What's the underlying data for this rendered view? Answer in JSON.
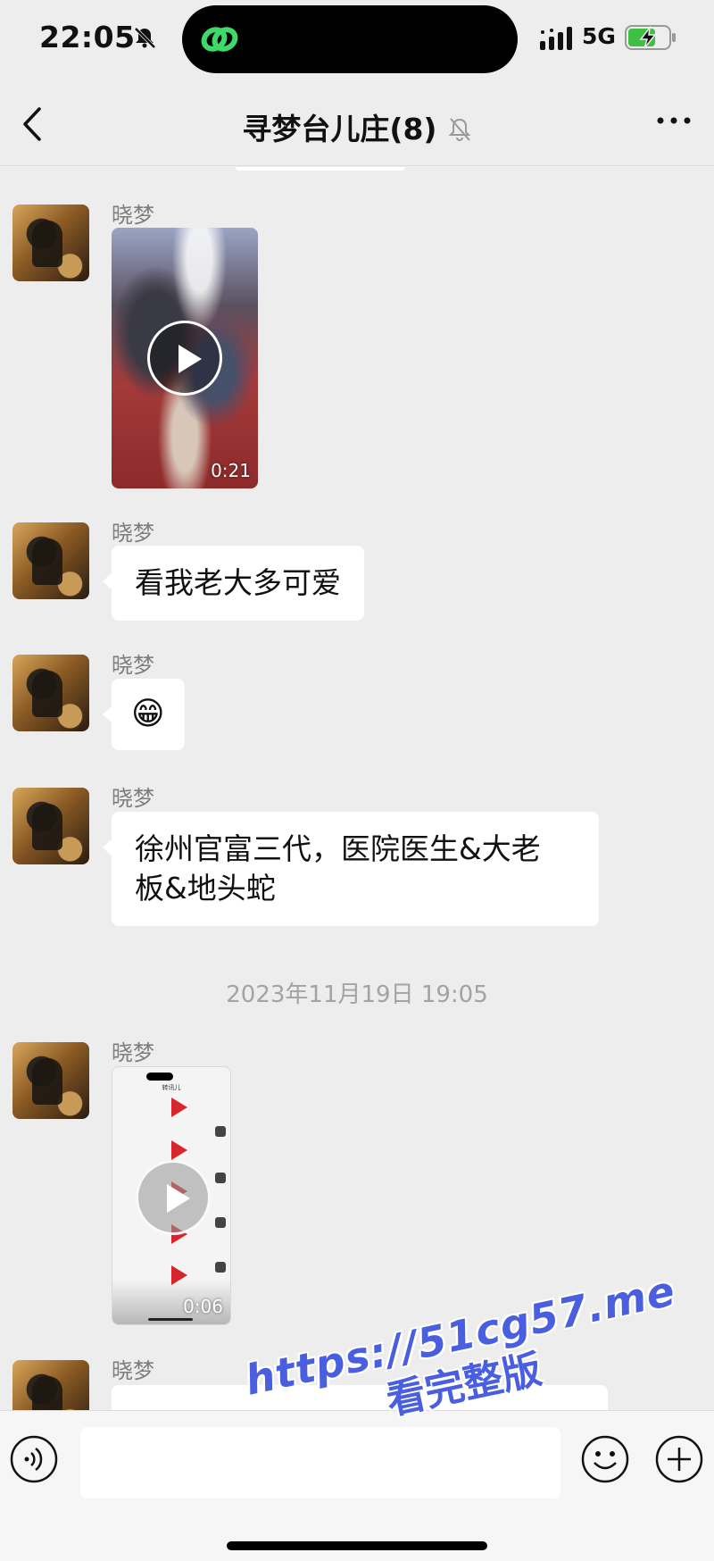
{
  "status_bar": {
    "time": "22:05",
    "network": "5G",
    "icons": [
      "bell-off-icon",
      "app-link-icon",
      "signal-icon",
      "battery-charging-icon"
    ]
  },
  "nav": {
    "title": "寻梦台儿庄(8)",
    "icons": [
      "back-icon",
      "mute-icon",
      "more-icon"
    ]
  },
  "messages": [
    {
      "type": "video",
      "sender": "晓梦",
      "duration": "0:21"
    },
    {
      "type": "text",
      "sender": "晓梦",
      "text": "看我老大多可爱"
    },
    {
      "type": "emoji",
      "sender": "晓梦",
      "emoji": "😁"
    },
    {
      "type": "text",
      "sender": "晓梦",
      "text_line1": "徐州官富三代，医院医生&大老",
      "text_line2": "板&地头蛇"
    },
    {
      "type": "timestamp",
      "text": "2023年11月19日 19:05"
    },
    {
      "type": "video",
      "sender": "晓梦",
      "duration": "0:06",
      "thumb_title": "转讯儿"
    },
    {
      "type": "text",
      "sender": "晓梦",
      "text": ""
    }
  ],
  "input_bar": {
    "icons": [
      "voice-icon",
      "emoji-icon",
      "plus-icon"
    ],
    "input_value": ""
  },
  "watermark": {
    "url": "https://51cg57.me",
    "subtitle": "看完整版"
  },
  "colors": {
    "background": "#ededed",
    "bubble": "#ffffff",
    "watermark": "#4a5fe0",
    "charging": "#3fbf46"
  }
}
